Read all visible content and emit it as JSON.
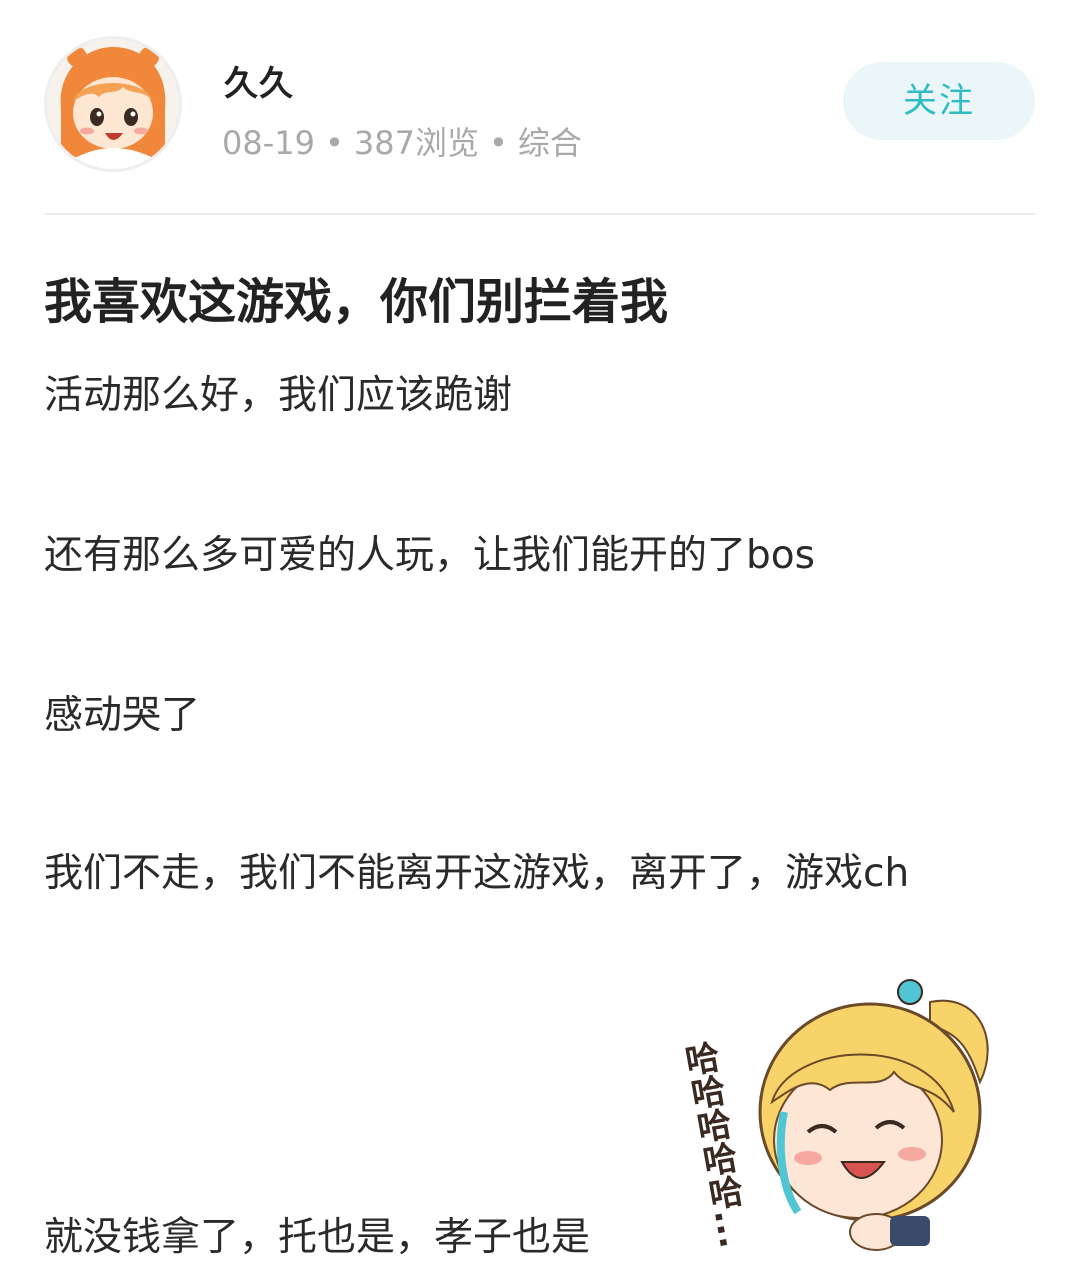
{
  "author": {
    "name": "久久",
    "date": "08-19",
    "views": "387浏览",
    "category": "综合",
    "follow_label": "关注"
  },
  "post": {
    "title": "我喜欢这游戏，你们别拦着我",
    "lines": [
      "活动那么好，我们应该跪谢",
      "还有那么多可爱的人玩，让我们能开的了bos",
      "感动哭了",
      "我们不走，我们不能离开这游戏，离开了，游戏ch",
      "就没钱拿了，托也是，孝子也是"
    ]
  },
  "sticker": {
    "text": "哈哈哈哈哈..."
  },
  "colors": {
    "accent": "#2fbcc5",
    "follow_bg": "#eaf6f7",
    "meta_text": "#a9a9a9"
  }
}
